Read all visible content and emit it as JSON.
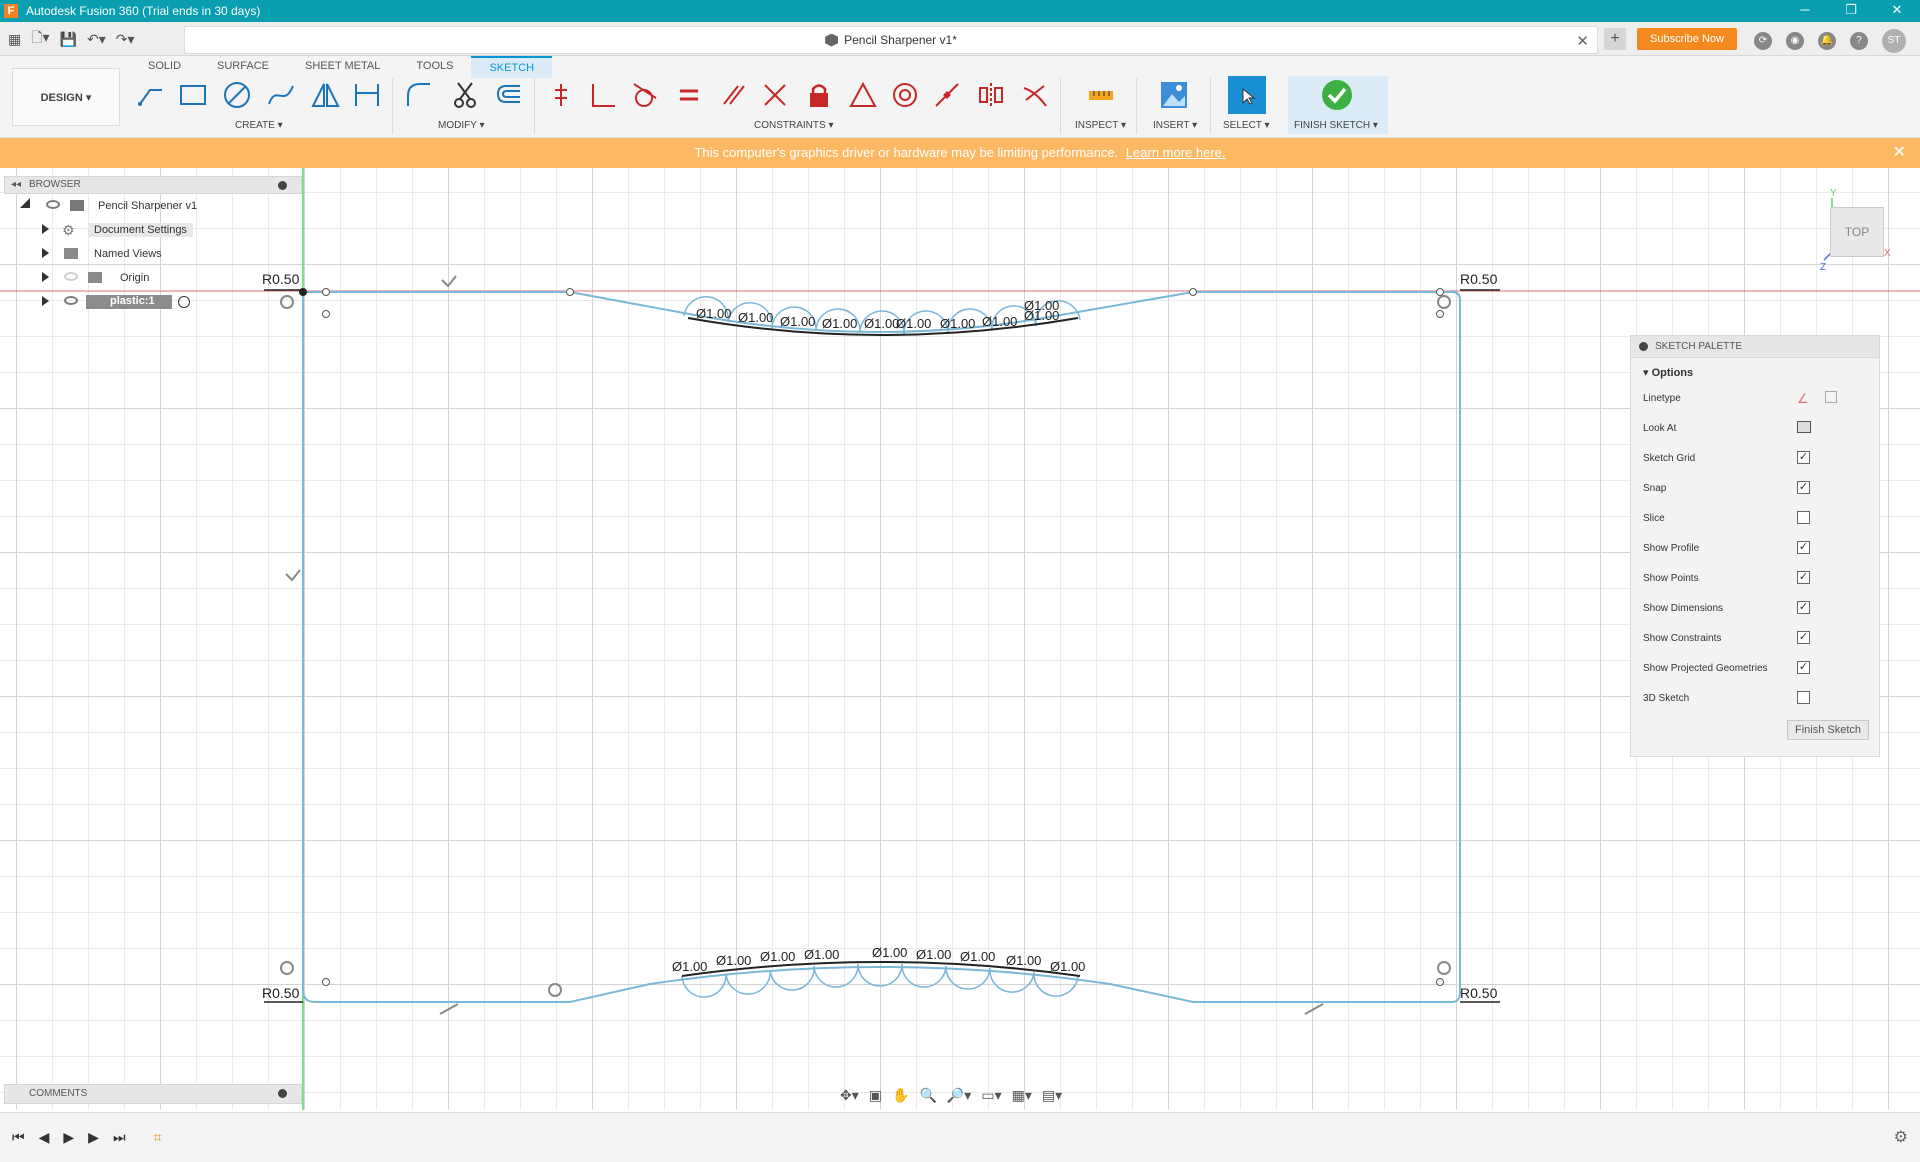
{
  "window": {
    "title": "Autodesk Fusion 360 (Trial ends in 30 days)",
    "app_icon": "F"
  },
  "doc_tab": {
    "title": "Pencil Sharpener v1*",
    "subscribe_label": "Subscribe Now",
    "avatar_initials": "ST"
  },
  "ribbon": {
    "tabs": [
      "SOLID",
      "SURFACE",
      "SHEET METAL",
      "TOOLS",
      "SKETCH"
    ],
    "workspace_label": "DESIGN ▾",
    "groups": {
      "create": "CREATE ▾",
      "modify": "MODIFY ▾",
      "constraints": "CONSTRAINTS ▾",
      "inspect": "INSPECT ▾",
      "insert": "INSERT ▾",
      "select": "SELECT ▾",
      "finish": "FINISH SKETCH ▾"
    }
  },
  "banner": {
    "text": "This computer's graphics driver or hardware may be limiting performance.",
    "link": "Learn more here."
  },
  "browser": {
    "title": "BROWSER",
    "items": [
      {
        "label": "Pencil Sharpener v1"
      },
      {
        "label": "Document Settings"
      },
      {
        "label": "Named Views"
      },
      {
        "label": "Origin"
      },
      {
        "label": "plastic:1"
      }
    ]
  },
  "comments": {
    "title": "COMMENTS"
  },
  "viewcube": {
    "face": "TOP",
    "axis_y": "Y",
    "axis_x": "X",
    "axis_z": "Z"
  },
  "sketch": {
    "radius_labels": [
      "R0.50",
      "R0.50",
      "R0.50",
      "R0.50"
    ],
    "top_dims": [
      "Ø1.00",
      "Ø1.00",
      "Ø1.00",
      "Ø1.00",
      "Ø1.00",
      "Ø1.00",
      "Ø1.00",
      "Ø1.00",
      "Ø1.00",
      "Ø1.00"
    ],
    "bottom_dims": [
      "Ø1.00",
      "Ø1.00",
      "Ø1.00",
      "Ø1.00",
      "Ø1.00",
      "Ø1.00",
      "Ø1.00",
      "Ø1.00",
      "Ø1.00"
    ]
  },
  "sketch_palette": {
    "title": "SKETCH PALETTE",
    "section": "Options",
    "options": [
      {
        "name": "Linetype",
        "checked": null
      },
      {
        "name": "Look At",
        "checked": null
      },
      {
        "name": "Sketch Grid",
        "checked": true
      },
      {
        "name": "Snap",
        "checked": true
      },
      {
        "name": "Slice",
        "checked": false
      },
      {
        "name": "Show Profile",
        "checked": true
      },
      {
        "name": "Show Points",
        "checked": true
      },
      {
        "name": "Show Dimensions",
        "checked": true
      },
      {
        "name": "Show Constraints",
        "checked": true
      },
      {
        "name": "Show Projected Geometries",
        "checked": true
      },
      {
        "name": "3D Sketch",
        "checked": false
      }
    ],
    "finish_button": "Finish Sketch"
  },
  "colors": {
    "title_bar": "#0a9fb0",
    "accent": "#0696d7",
    "banner": "#fdb863",
    "sketch_line": "#7ab8d8",
    "subscribe": "#f48a1e"
  }
}
